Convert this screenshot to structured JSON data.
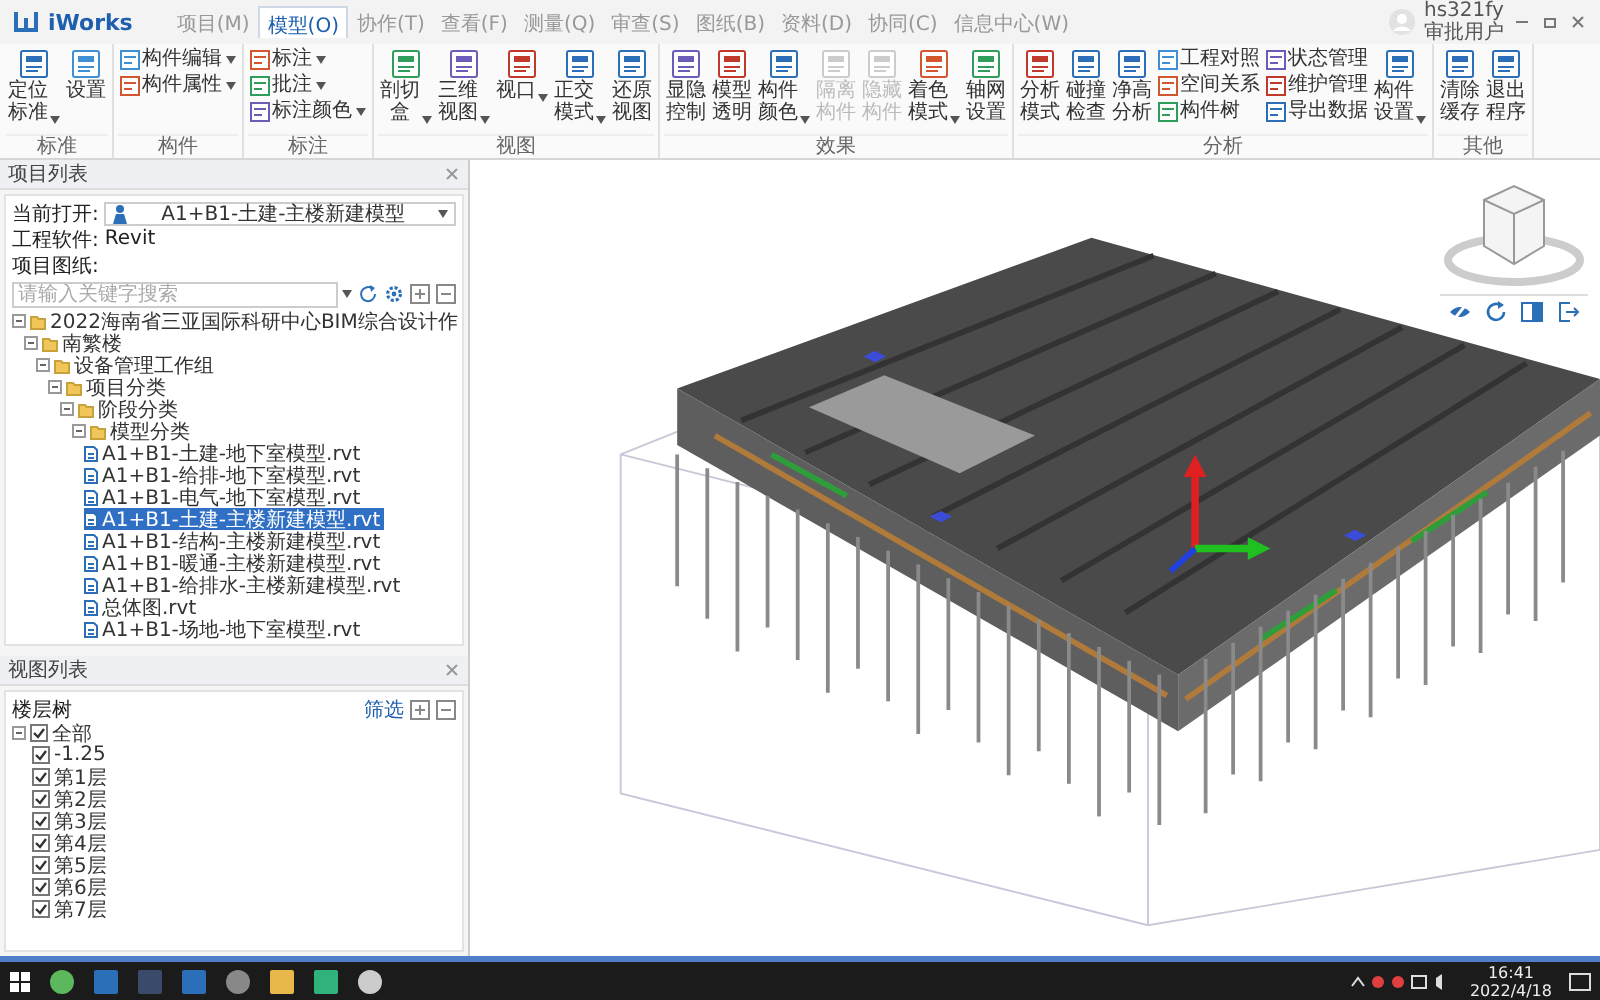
{
  "app": {
    "name": "iWorks"
  },
  "menu_tabs": [
    {
      "label": "项目(M)",
      "selected": false
    },
    {
      "label": "模型(O)",
      "selected": true
    },
    {
      "label": "协作(T)",
      "selected": false
    },
    {
      "label": "查看(F)",
      "selected": false
    },
    {
      "label": "测量(Q)",
      "selected": false
    },
    {
      "label": "审查(S)",
      "selected": false
    },
    {
      "label": "图纸(B)",
      "selected": false
    },
    {
      "label": "资料(D)",
      "selected": false
    },
    {
      "label": "协同(C)",
      "selected": false
    },
    {
      "label": "信息中心(W)",
      "selected": false
    }
  ],
  "user": {
    "name": "hs321fy",
    "role": "审批用户"
  },
  "ribbon": {
    "groups": [
      {
        "label": "标准",
        "items": [
          {
            "kind": "large",
            "label": "定位标准",
            "dropdown": true,
            "disabled": false
          },
          {
            "kind": "large",
            "label": "设置",
            "dropdown": false,
            "disabled": false
          }
        ]
      },
      {
        "label": "构件",
        "items": [
          {
            "kind": "small",
            "label": "构件编辑",
            "dropdown": true,
            "disabled": false
          },
          {
            "kind": "small",
            "label": "构件属性",
            "dropdown": true,
            "disabled": false
          }
        ]
      },
      {
        "label": "标注",
        "items": [
          {
            "kind": "small",
            "label": "标注",
            "dropdown": true,
            "disabled": false
          },
          {
            "kind": "small",
            "label": "批注",
            "dropdown": true,
            "disabled": false
          },
          {
            "kind": "small",
            "label": "标注颜色",
            "dropdown": true,
            "disabled": false
          }
        ]
      },
      {
        "label": "视图",
        "items": [
          {
            "kind": "large",
            "label": "剖切盒",
            "dropdown": true,
            "disabled": false
          },
          {
            "kind": "large",
            "label": "三维视图",
            "dropdown": true,
            "disabled": false
          },
          {
            "kind": "large",
            "label": "视口",
            "dropdown": true,
            "disabled": false
          },
          {
            "kind": "large",
            "label": "正交模式",
            "dropdown": true,
            "disabled": false
          },
          {
            "kind": "large",
            "label": "还原视图",
            "dropdown": false,
            "disabled": false
          }
        ]
      },
      {
        "label": "效果",
        "items": [
          {
            "kind": "large",
            "label": "显隐控制",
            "dropdown": false,
            "disabled": false
          },
          {
            "kind": "large",
            "label": "模型透明",
            "dropdown": false,
            "disabled": false
          },
          {
            "kind": "large",
            "label": "构件颜色",
            "dropdown": true,
            "disabled": false
          },
          {
            "kind": "large",
            "label": "隔离构件",
            "dropdown": false,
            "disabled": true
          },
          {
            "kind": "large",
            "label": "隐藏构件",
            "dropdown": false,
            "disabled": true
          },
          {
            "kind": "large",
            "label": "着色模式",
            "dropdown": true,
            "disabled": false
          },
          {
            "kind": "large",
            "label": "轴网设置",
            "dropdown": false,
            "disabled": false
          }
        ]
      },
      {
        "label": "分析",
        "items": [
          {
            "kind": "large",
            "label": "分析模式",
            "dropdown": false,
            "disabled": false
          },
          {
            "kind": "large",
            "label": "碰撞检查",
            "dropdown": false,
            "disabled": false
          },
          {
            "kind": "large",
            "label": "净高分析",
            "dropdown": false,
            "disabled": false
          },
          {
            "kind": "small",
            "label": "工程对照",
            "dropdown": false,
            "disabled": false
          },
          {
            "kind": "small",
            "label": "空间关系",
            "dropdown": false,
            "disabled": false
          },
          {
            "kind": "small",
            "label": "构件树",
            "dropdown": false,
            "disabled": false
          },
          {
            "kind": "small",
            "label": "状态管理",
            "dropdown": false,
            "disabled": false
          },
          {
            "kind": "small",
            "label": "维护管理",
            "dropdown": false,
            "disabled": false
          },
          {
            "kind": "small",
            "label": "导出数据",
            "dropdown": false,
            "disabled": false
          },
          {
            "kind": "large",
            "label": "构件设置",
            "dropdown": true,
            "disabled": false
          }
        ]
      },
      {
        "label": "其他",
        "items": [
          {
            "kind": "large",
            "label": "清除缓存",
            "dropdown": false,
            "disabled": false
          },
          {
            "kind": "large",
            "label": "退出程序",
            "dropdown": false,
            "disabled": false
          }
        ]
      }
    ]
  },
  "project_panel": {
    "title": "项目列表",
    "current_label": "当前打开:",
    "current_value": "A1+B1-土建-主楼新建模型",
    "software_label": "工程软件:",
    "software_value": "Revit",
    "drawings_label": "项目图纸:",
    "search": {
      "placeholder": "请输入关键字搜索"
    },
    "tree": [
      {
        "label": "2022海南省三亚国际科研中心BIM综合设计作",
        "selected": false,
        "expanded": true,
        "children": [
          {
            "label": "南繁楼",
            "selected": false,
            "expanded": true,
            "children": [
              {
                "label": "设备管理工作组",
                "selected": false,
                "expanded": true,
                "children": [
                  {
                    "label": "项目分类",
                    "selected": false,
                    "expanded": true,
                    "children": [
                      {
                        "label": "阶段分类",
                        "selected": false,
                        "expanded": true,
                        "children": [
                          {
                            "label": "模型分类",
                            "selected": false,
                            "expanded": true,
                            "children": [
                              {
                                "label": "A1+B1-土建-地下室模型.rvt",
                                "selected": false
                              },
                              {
                                "label": "A1+B1-给排-地下室模型.rvt",
                                "selected": false
                              },
                              {
                                "label": "A1+B1-电气-地下室模型.rvt",
                                "selected": false
                              },
                              {
                                "label": "A1+B1-土建-主楼新建模型.rvt",
                                "selected": true
                              },
                              {
                                "label": "A1+B1-结构-主楼新建模型.rvt",
                                "selected": false
                              },
                              {
                                "label": "A1+B1-暖通-主楼新建模型.rvt",
                                "selected": false
                              },
                              {
                                "label": "A1+B1-给排水-主楼新建模型.rvt",
                                "selected": false
                              },
                              {
                                "label": "总体图.rvt",
                                "selected": false
                              },
                              {
                                "label": "A1+B1-场地-地下室模型.rvt",
                                "selected": false
                              }
                            ]
                          }
                        ]
                      }
                    ]
                  }
                ]
              }
            ]
          }
        ]
      }
    ]
  },
  "view_panel": {
    "title": "视图列表",
    "tree_label": "楼层树",
    "filter_link": "筛选",
    "tree": [
      {
        "label": "全部",
        "checked": true,
        "expanded": true,
        "children": [
          {
            "label": "-1.25",
            "checked": true
          },
          {
            "label": "第1层",
            "checked": true
          },
          {
            "label": "第2层",
            "checked": true
          },
          {
            "label": "第3层",
            "checked": true
          },
          {
            "label": "第4层",
            "checked": true
          },
          {
            "label": "第5层",
            "checked": true
          },
          {
            "label": "第6层",
            "checked": true
          },
          {
            "label": "第7层",
            "checked": true
          }
        ]
      }
    ]
  },
  "taskbar": {
    "time": "16:41",
    "date": "2022/4/18"
  }
}
